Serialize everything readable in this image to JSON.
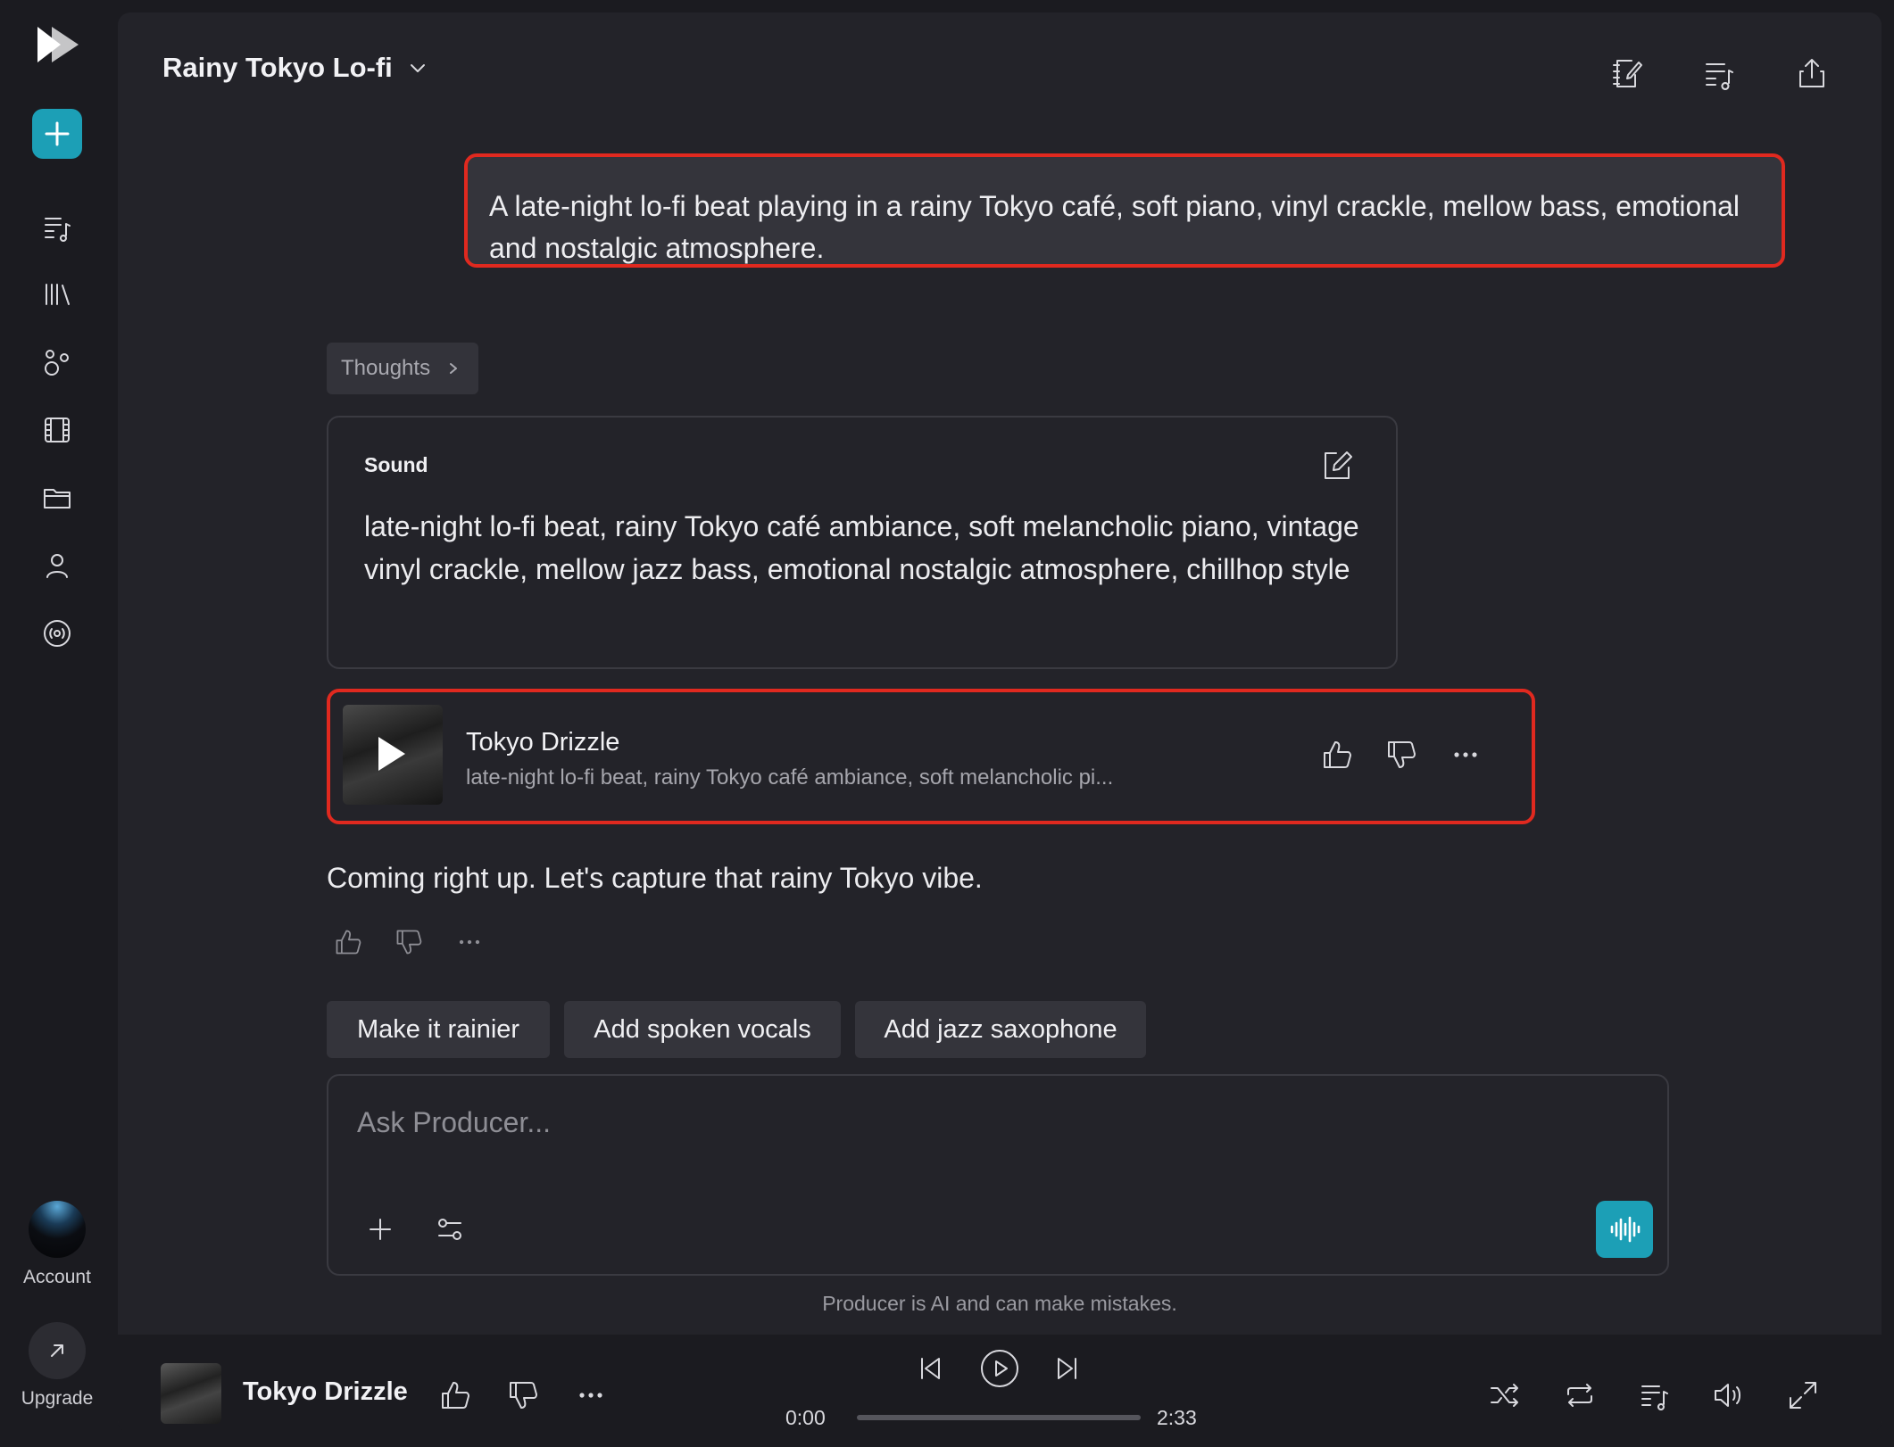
{
  "sidebar": {
    "items": [
      {
        "icon": "playlist-icon"
      },
      {
        "icon": "library-icon"
      },
      {
        "icon": "community-icon"
      },
      {
        "icon": "video-icon"
      },
      {
        "icon": "folder-icon"
      },
      {
        "icon": "profile-icon"
      },
      {
        "icon": "radio-icon"
      }
    ],
    "account_label": "Account",
    "upgrade_label": "Upgrade"
  },
  "header": {
    "title": "Rainy Tokyo Lo-fi"
  },
  "chat": {
    "user_prompt": "A late-night lo-fi beat playing in a rainy Tokyo café, soft piano, vinyl crackle, mellow bass, emotional and nostalgic atmosphere.",
    "thoughts_label": "Thoughts",
    "sound_card": {
      "label": "Sound",
      "text": "late-night lo-fi beat, rainy Tokyo café ambiance, soft melancholic piano, vintage vinyl crackle, mellow jazz bass, emotional nostalgic atmosphere, chillhop style"
    },
    "track": {
      "title": "Tokyo Drizzle",
      "description": "late-night lo-fi beat, rainy Tokyo café ambiance, soft melancholic pi..."
    },
    "reply": "Coming right up. Let's capture that rainy Tokyo vibe.",
    "suggestions": [
      "Make it rainier",
      "Add spoken vocals",
      "Add jazz saxophone"
    ]
  },
  "composer": {
    "placeholder": "Ask Producer...",
    "disclaimer": "Producer is AI and can make mistakes."
  },
  "player": {
    "title": "Tokyo Drizzle",
    "current_time": "0:00",
    "total_time": "2:33",
    "progress": 0
  },
  "colors": {
    "accent": "#1c9fb6",
    "highlight_border": "#e0291f",
    "panel_bg": "#232329",
    "app_bg": "#1b1b20"
  }
}
